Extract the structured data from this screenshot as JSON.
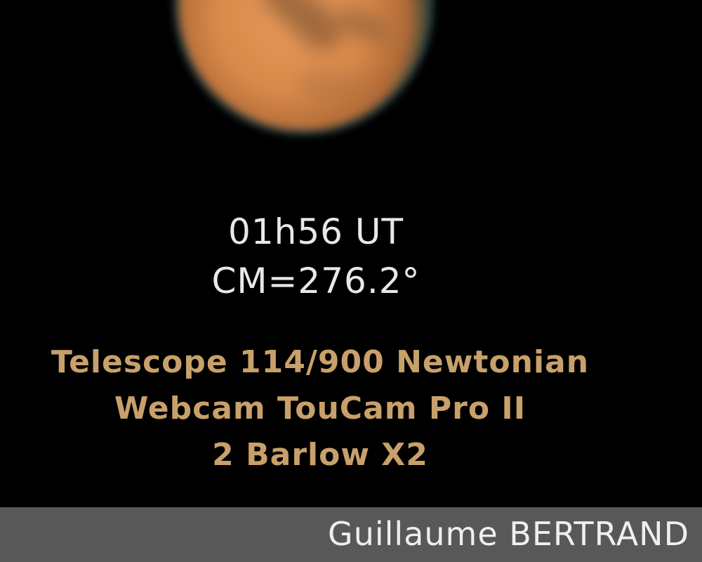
{
  "image": {
    "subject": "planet-mars-photo",
    "colors": {
      "background": "#000000",
      "planet_main": "#d8894a",
      "planet_dark_marking": "#8a5a34",
      "caption_white": "#e8e8e8",
      "caption_tan": "#c8a06a",
      "credit_bar": "#585858",
      "credit_text": "#efefef"
    }
  },
  "observation": {
    "time": "01h56 UT",
    "central_meridian": "CM=276.2°"
  },
  "equipment": {
    "line1": "Telescope 114/900 Newtonian",
    "line2": "Webcam TouCam Pro II",
    "line3": "2 Barlow X2"
  },
  "credit": {
    "author": "Guillaume BERTRAND"
  }
}
